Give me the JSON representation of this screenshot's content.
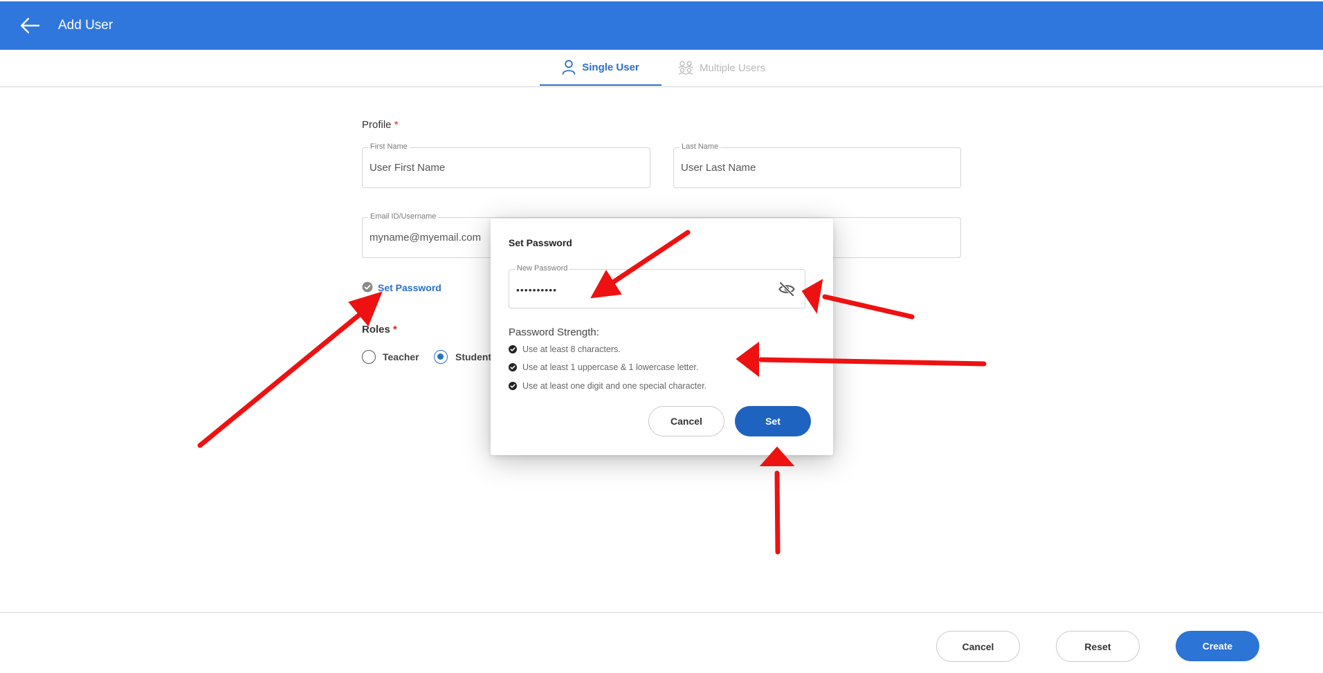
{
  "header": {
    "title": "Add User",
    "background": "#3077dd"
  },
  "tabs": [
    {
      "label": "Single User",
      "active": true,
      "icon": "user-icon"
    },
    {
      "label": "Multiple Users",
      "active": false,
      "icon": "users-icon"
    }
  ],
  "form": {
    "profile_label": "Profile",
    "required_mark": "*",
    "first_name": {
      "label": "First Name",
      "placeholder": "User First Name",
      "value": ""
    },
    "last_name": {
      "label": "Last Name",
      "placeholder": "User Last Name",
      "value": ""
    },
    "email": {
      "label": "Email ID/Username",
      "placeholder": "myname@myemail.com",
      "value": ""
    },
    "set_password_link": "Set Password",
    "roles_label": "Roles",
    "roles": [
      {
        "label": "Teacher",
        "selected": false
      },
      {
        "label": "Student",
        "selected": true
      }
    ]
  },
  "modal": {
    "title": "Set Password",
    "new_password": {
      "label": "New Password",
      "value": "••••••••••"
    },
    "strength_title": "Password Strength:",
    "rules": [
      "Use at least 8 characters.",
      "Use at least 1 uppercase & 1 lowercase letter.",
      "Use at least one digit and one special character."
    ],
    "cancel_label": "Cancel",
    "set_label": "Set"
  },
  "footer": {
    "cancel_label": "Cancel",
    "reset_label": "Reset",
    "create_label": "Create"
  },
  "colors": {
    "accent": "#2a6fc9",
    "primary_button": "#1e63c0",
    "annotation_arrow": "#ee1111"
  }
}
